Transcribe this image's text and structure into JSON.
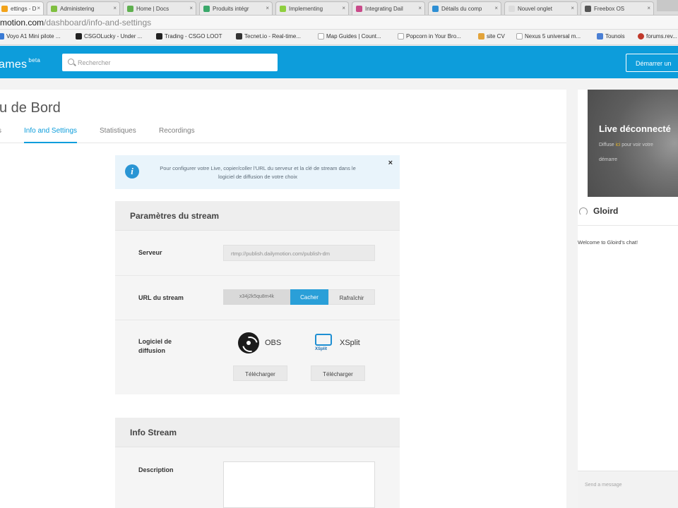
{
  "browser": {
    "tabs": [
      {
        "title": "ettings - D",
        "color": "#f2a31b"
      },
      {
        "title": "Administering",
        "color": "#7fbf3f"
      },
      {
        "title": "Home | Docs",
        "color": "#5fb04f"
      },
      {
        "title": "Produits intégr",
        "color": "#3aa86a"
      },
      {
        "title": "Implementing",
        "color": "#8fcf3f"
      },
      {
        "title": "Integrating Dail",
        "color": "#c94a8a"
      },
      {
        "title": "Détails du comp",
        "color": "#2e8fd4"
      },
      {
        "title": "Nouvel onglet",
        "color": "#dcdcdc"
      },
      {
        "title": "Freebox OS",
        "color": "#555555"
      }
    ],
    "url_host": "motion.com",
    "url_path": "/dashboard/info-and-settings",
    "bookmarks": [
      {
        "label": "Voyo A1 Mini pilote ...",
        "color": "#3a7bd5"
      },
      {
        "label": "CSGOLucky - Under ...",
        "color": "#222222"
      },
      {
        "label": "Trading - CSGO LOOT",
        "color": "#222222"
      },
      {
        "label": "Tecnet.io - Real-time...",
        "color": "#333333"
      },
      {
        "label": "Map Guides | Count...",
        "color": "#ffffff"
      },
      {
        "label": "Popcorn in Your Bro...",
        "color": "#ffffff"
      },
      {
        "label": "site CV",
        "color": "#e2a33a"
      },
      {
        "label": "Nexus 5 universal m...",
        "color": "#ffffff"
      },
      {
        "label": "Tounois",
        "color": "#4a7fd4"
      },
      {
        "label": "forums.rev...",
        "color": "#c0392b"
      }
    ]
  },
  "header": {
    "logo_text": "ames",
    "logo_badge": "beta",
    "search_placeholder": "Rechercher",
    "start_button": "Démarrer un"
  },
  "page": {
    "title": "u de Bord",
    "stub_tab": "s",
    "tabs": [
      {
        "label": "Info and Settings",
        "active": true
      },
      {
        "label": "Statistiques",
        "active": false
      },
      {
        "label": "Recordings",
        "active": false
      }
    ]
  },
  "banner": {
    "text": "Pour configurer votre Live, copier/coller l'URL du serveur et la clé de stream dans le logiciel de diffusion de votre choix",
    "close": "×"
  },
  "stream_params": {
    "title": "Paramètres du stream",
    "server_label": "Serveur",
    "server_value": "rtmp://publish.dailymotion.com/publish-dm",
    "url_label": "URL du stream",
    "url_key": "x34j2k5qu8m4k",
    "hide_button": "Cacher",
    "refresh_button": "Rafraîchir",
    "software_label": "Logiciel de diffusion",
    "obs_name": "OBS",
    "xsplit_name": "XSplit",
    "xsplit_mark": "XSplit",
    "download_label": "Télécharger"
  },
  "info_stream": {
    "title": "Info Stream",
    "description_label": "Description"
  },
  "player": {
    "status": "Live déconnecté",
    "hint_prefix": "Diffuse",
    "hint_highlight": "ici",
    "hint_suffix": "pour voir votre",
    "hint2": "démarre"
  },
  "chat": {
    "username": "Gloird",
    "welcome": "Welcome to Gloird's chat!",
    "input_placeholder": "Send a message"
  },
  "colors": {
    "brand_blue": "#0d9ddb",
    "button_blue": "#2a9fd8"
  }
}
